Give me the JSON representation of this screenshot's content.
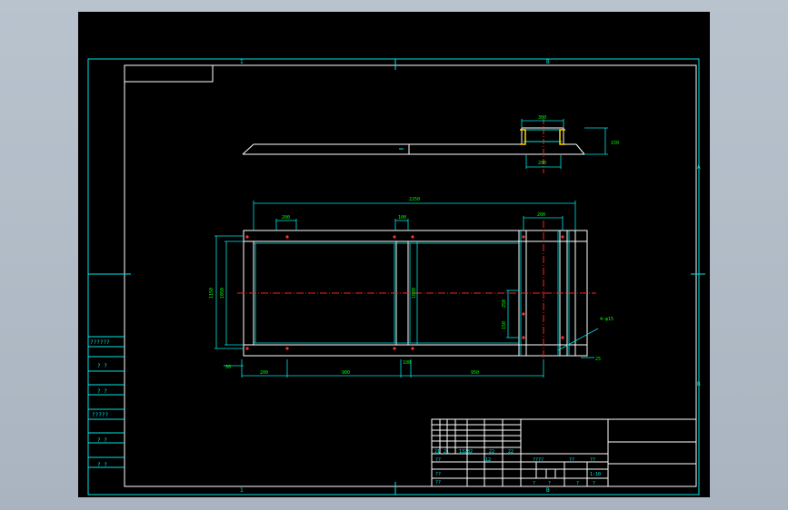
{
  "colors": {
    "frame": "#00e5e5",
    "geometry": "#ffffff",
    "dimension": "#00ff00",
    "centerline": "#ff2020",
    "background": "#000000",
    "outside": "#b5bfca"
  },
  "zone_labels": {
    "top_left": "1",
    "top_right": "B",
    "bottom_left": "1",
    "bottom_right": "B",
    "right_upper": "A",
    "right_lower": "B"
  },
  "top_view_dims": {
    "top_width": "300",
    "height": "150",
    "bottom_width": "200"
  },
  "plan_dims": {
    "overall": "2250",
    "top_a": "200",
    "top_b": "100",
    "top_c": "200",
    "left_outer": "1150",
    "left_inner": "1050",
    "mid_vertical": "1000",
    "right_a": "250",
    "right_b": "150",
    "bottom_a": "200",
    "bottom_b": "900",
    "bottom_c": "100",
    "bottom_d": "950",
    "left_small": "50",
    "right_small": "25",
    "leader_note": "4-φ15"
  },
  "side_table": [
    "??????",
    "? ?",
    "? ?",
    "?????",
    "? ?",
    "? ?"
  ],
  "title_block": {
    "r1": [
      "21",
      "21",
      "13282",
      "22",
      "22"
    ],
    "r2": [
      "??",
      "?12",
      "????",
      "??",
      "??"
    ],
    "r3": [
      "??",
      "1:10"
    ],
    "r4": [
      "??",
      "?",
      "?",
      "?",
      "?"
    ]
  }
}
